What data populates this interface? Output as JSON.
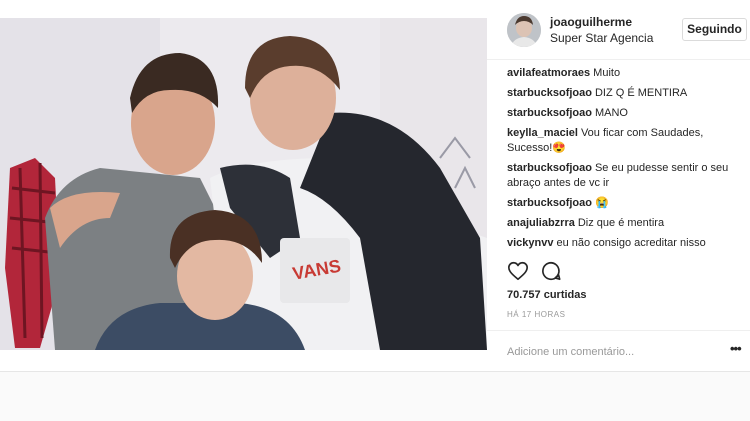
{
  "post": {
    "photo_alt": "",
    "author": {
      "username": "joaoguilherme",
      "location": "Super Star Agencia"
    },
    "follow_label": "Seguindo",
    "comments": [
      {
        "user": "avilafeatmoraes",
        "text": "Muito"
      },
      {
        "user": "starbucksofjoao",
        "text": "DIZ Q É MENTIRA"
      },
      {
        "user": "starbucksofjoao",
        "text": "MANO"
      },
      {
        "user": "keylla_maciel",
        "text": "Vou ficar com Saudades, Sucesso!😍"
      },
      {
        "user": "starbucksofjoao",
        "text": "Se eu pudesse sentir o seu abraço antes de vc ir"
      },
      {
        "user": "starbucksofjoao",
        "text": "😭"
      },
      {
        "user": "anajuliabzrra",
        "text": "Diz que é mentira"
      },
      {
        "user": "vickynvv",
        "text": "eu não consigo acreditar nisso"
      }
    ],
    "icons": {
      "like": "heart-icon",
      "comment": "comment-bubble-icon",
      "more": "more-options-icon"
    },
    "likes": "70.757 curtidas",
    "timestamp": "HÁ 17 HORAS",
    "comment_placeholder": "Adicione um comentário...",
    "more_label": "•••"
  }
}
